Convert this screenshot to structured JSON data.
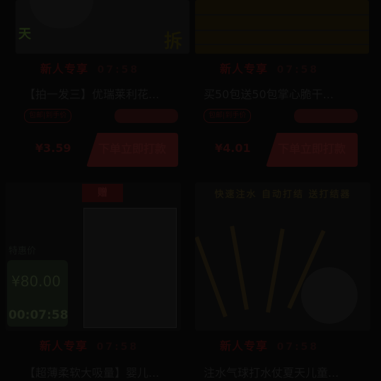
{
  "cards": [
    {
      "promo": "新人专享",
      "time": "07:58",
      "title": "【拍一发三】优瑞莱利花...",
      "tag": "包邮|到手价",
      "price": "¥3.59",
      "button": "下单立即打款"
    },
    {
      "promo": "新人专享",
      "time": "07:58",
      "title": "买50包送50包掌心脆干...",
      "tag": "包邮|到手价",
      "price": "¥4.01",
      "button": "下单立即打款"
    },
    {
      "promo": "新人专享",
      "time": "07:58",
      "title": "【超薄柔软大吸量】婴儿...",
      "badge": "赠",
      "countdown_label": "特惠价",
      "countdown_price": "¥80.00",
      "countdown_time": "00:07:58"
    },
    {
      "promo": "新人专享",
      "time": "07:58",
      "title": "注水气球打水仗夏天儿童...",
      "banner": "快速注水 自动打结 送打结器"
    }
  ],
  "colors": {
    "background": "#050505",
    "accent_dim": "#220a0a"
  }
}
